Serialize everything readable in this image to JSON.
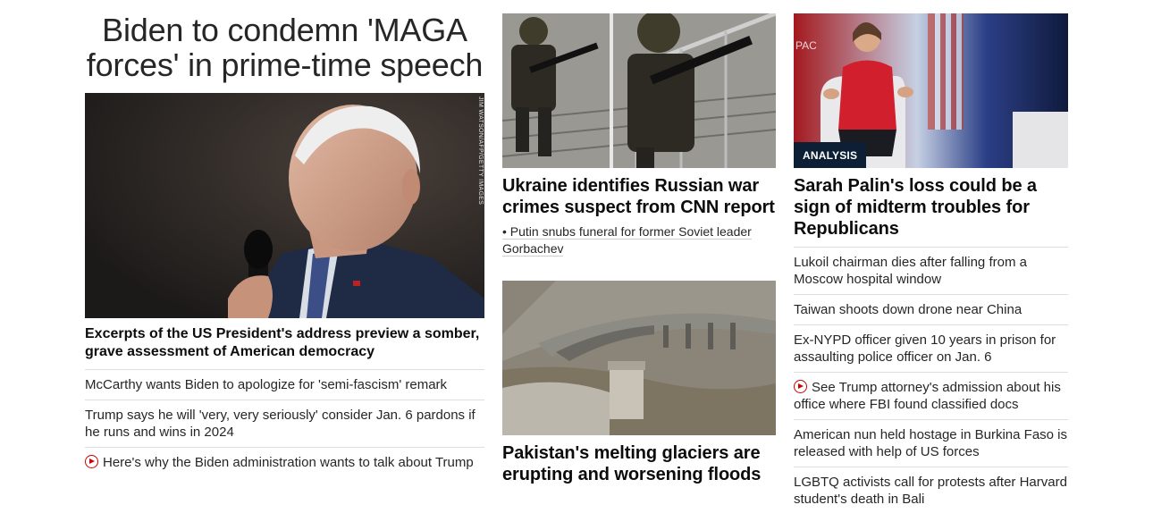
{
  "lead": {
    "headline": "Biden to condemn 'MAGA forces' in prime-time speech",
    "image_credit": "JIM WATSON/AFP/GETTY IMAGES",
    "subheadline": "Excerpts of the US President's address preview a somber, grave assessment of American democracy",
    "links": [
      {
        "text": "McCarthy wants Biden to apologize for 'semi-fascism' remark",
        "video": false
      },
      {
        "text": "Trump says he will 'very, very seriously' consider Jan. 6 pardons if he runs and wins in 2024",
        "video": false
      },
      {
        "text": "Here's why the Biden administration wants to talk about Trump",
        "video": true
      }
    ]
  },
  "middle": {
    "ukraine": {
      "headline": "Ukraine identifies Russian war crimes suspect from CNN report",
      "related": "• Putin snubs funeral for former Soviet leader Gorbachev"
    },
    "pakistan": {
      "headline": "Pakistan's melting glaciers are erupting and worsening floods"
    }
  },
  "right": {
    "badge": "ANALYSIS",
    "image_sign": "PAC",
    "headline": "Sarah Palin's loss could be a sign of midterm troubles for Republicans",
    "links": [
      {
        "text": "Lukoil chairman dies after falling from a Moscow hospital window",
        "video": false
      },
      {
        "text": "Taiwan shoots down drone near China",
        "video": false
      },
      {
        "text": "Ex-NYPD officer given 10 years in prison for assaulting police officer on Jan. 6",
        "video": false
      },
      {
        "text": "See Trump attorney's admission about his office where FBI found classified docs",
        "video": true
      },
      {
        "text": "American nun held hostage in Burkina Faso is released with help of US forces",
        "video": false
      },
      {
        "text": "LGBTQ activists call for protests after Harvard student's death in Bali",
        "video": false
      }
    ]
  },
  "colors": {
    "video_icon": "#cc0000",
    "badge_bg": "#0c1f35",
    "divider": "#dedede"
  }
}
